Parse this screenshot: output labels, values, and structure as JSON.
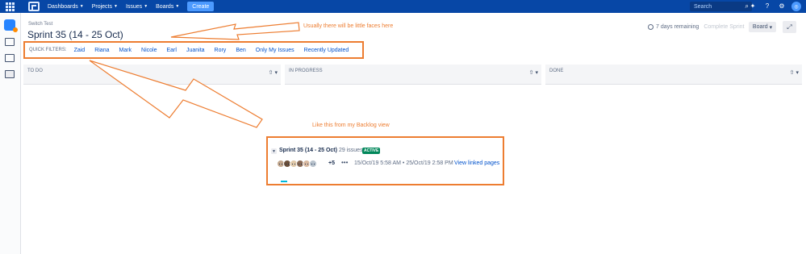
{
  "topnav": {
    "items": [
      {
        "label": "Dashboards"
      },
      {
        "label": "Projects"
      },
      {
        "label": "Issues"
      },
      {
        "label": "Boards"
      }
    ],
    "create_label": "Create",
    "search_placeholder": "Search",
    "bg_color": "#0747a6",
    "icons": [
      "app-switcher-icon",
      "jira-logo-icon",
      "search-icon",
      "notifications-icon",
      "help-icon",
      "settings-icon",
      "profile-avatar-icon"
    ]
  },
  "header": {
    "project_name": "Switch Test",
    "sprint_title": "Sprint 35 (14 - 25 Oct)",
    "remaining": "7 days remaining",
    "complete_label": "Complete Sprint",
    "board_label": "Board"
  },
  "quick_filters": {
    "label": "QUICK FILTERS:",
    "items": [
      {
        "label": "Zaid"
      },
      {
        "label": "Riana"
      },
      {
        "label": "Mark"
      },
      {
        "label": "Nicole"
      },
      {
        "label": "Earl"
      },
      {
        "label": "Juanita"
      },
      {
        "label": "Rory"
      },
      {
        "label": "Ben"
      },
      {
        "label": "Only My Issues"
      },
      {
        "label": "Recently Updated"
      }
    ]
  },
  "columns": [
    {
      "title": "TO DO"
    },
    {
      "title": "IN PROGRESS"
    },
    {
      "title": "DONE"
    }
  ],
  "annotations": {
    "faces_note": "Usually there will be little faces here",
    "backlog_note": "Like this from my Backlog view",
    "color": "#ed7d31"
  },
  "backlog": {
    "sprint_title": "Sprint 35 (14 - 25 Oct)",
    "issue_count": "29 issues",
    "status": "ACTIVE",
    "more_avatars": "+5",
    "dates": "15/Oct/19 5:58 AM • 25/Oct/19 2:58 PM",
    "link": "View linked pages",
    "status_color": "#00875a"
  }
}
